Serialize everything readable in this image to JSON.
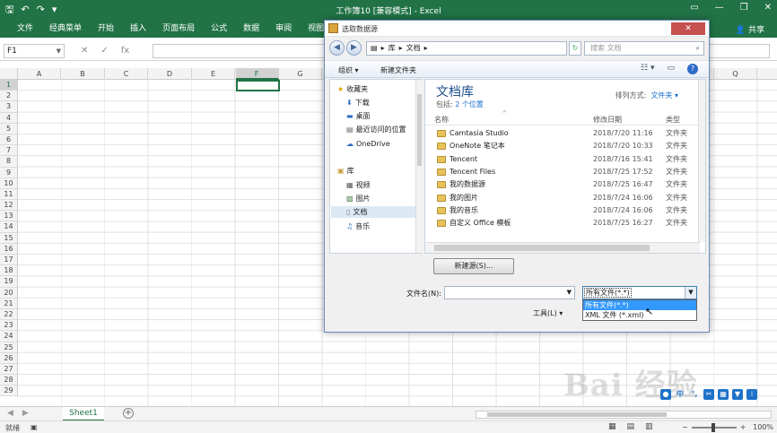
{
  "excel": {
    "title": "工作簿10  [兼容模式]  -  Excel",
    "ribbon_tabs": [
      "文件",
      "经典菜单",
      "开始",
      "插入",
      "页面布局",
      "公式",
      "数据",
      "审阅",
      "视图"
    ],
    "share": "共享",
    "name_box": "F1",
    "fx": "fx",
    "columns": [
      "A",
      "B",
      "C",
      "D",
      "E",
      "F",
      "G",
      "",
      "",
      "",
      "",
      "",
      "",
      "",
      "",
      "",
      "Q",
      "R"
    ],
    "selected_column": "F",
    "rows": [
      "1",
      "2",
      "3",
      "4",
      "5",
      "6",
      "7",
      "8",
      "9",
      "10",
      "11",
      "12",
      "13",
      "14",
      "15",
      "16",
      "17",
      "18",
      "19",
      "20",
      "21",
      "22",
      "23",
      "24",
      "25",
      "26",
      "27",
      "28",
      "29"
    ],
    "sheet_tab": "Sheet1",
    "status_ready": "就绪",
    "zoom": "100%",
    "watermark": "Bai 经验"
  },
  "dialog": {
    "title": "选取数据源",
    "close": "✕",
    "path": [
      "库",
      "文档"
    ],
    "search_placeholder": "搜索 文档",
    "organize": "组织 ▾",
    "new_folder": "新建文件夹",
    "nav": {
      "favorites": "收藏夹",
      "downloads": "下载",
      "desktop": "桌面",
      "recent": "最近访问的位置",
      "onedrive": "OneDrive",
      "libraries": "库",
      "videos": "视频",
      "pictures": "图片",
      "documents": "文档",
      "music": "音乐"
    },
    "library_title": "文档库",
    "library_includes_label": "包括:",
    "library_includes": "2 个位置",
    "arrange_label": "排列方式:",
    "arrange_value": "文件夹 ▾",
    "col_name": "名称",
    "col_date": "修改日期",
    "col_type": "类型",
    "files": [
      {
        "name": "Camtasia Studio",
        "date": "2018/7/20 11:16",
        "type": "文件夹"
      },
      {
        "name": "OneNote 笔记本",
        "date": "2018/7/20 10:33",
        "type": "文件夹"
      },
      {
        "name": "Tencent",
        "date": "2018/7/16 15:41",
        "type": "文件夹"
      },
      {
        "name": "Tencent Files",
        "date": "2018/7/25 17:52",
        "type": "文件夹"
      },
      {
        "name": "我的数据源",
        "date": "2018/7/25 16:47",
        "type": "文件夹"
      },
      {
        "name": "我的图片",
        "date": "2018/7/24 16:06",
        "type": "文件夹"
      },
      {
        "name": "我的音乐",
        "date": "2018/7/24 16:06",
        "type": "文件夹"
      },
      {
        "name": "自定义 Office 模板",
        "date": "2018/7/25 16:27",
        "type": "文件夹"
      }
    ],
    "new_source": "新建源(S)...",
    "file_name_label": "文件名(N):",
    "file_name_value": "",
    "file_type_value": "所有文件(*.*)",
    "file_type_options": [
      "所有文件(*.*)",
      "XML 文件 (*.xml)"
    ],
    "tools": "工具(L)   ▾"
  }
}
